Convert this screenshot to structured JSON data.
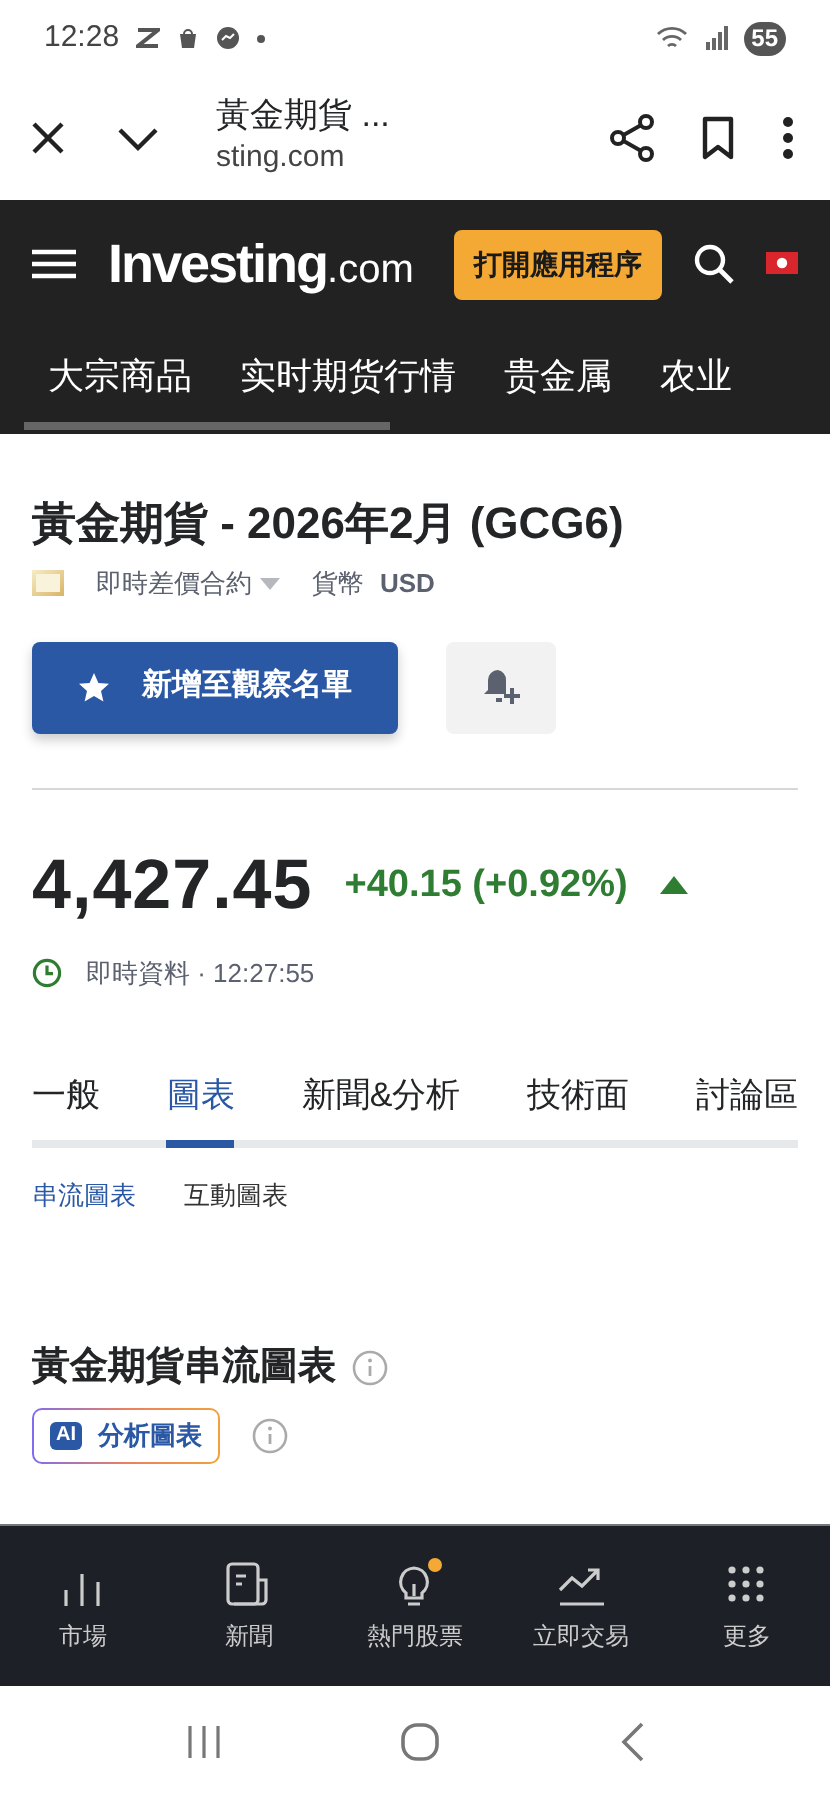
{
  "status_bar": {
    "time": "12:28",
    "battery": "55"
  },
  "browser": {
    "title": "黃金期貨 ...",
    "url": "sting.com"
  },
  "header": {
    "logo_main": "Investing",
    "logo_suffix": ".com",
    "cta": "打開應用程序"
  },
  "categories": [
    {
      "label": "大宗商品"
    },
    {
      "label": "实时期货行情"
    },
    {
      "label": "贵金属"
    },
    {
      "label": "农业"
    }
  ],
  "instrument": {
    "title": "黃金期貨 - 2026年2月 (GCG6)",
    "contract_type": "即時差價合約",
    "currency_label": "貨幣",
    "currency": "USD"
  },
  "watchlist_button": "新增至觀察名單",
  "price": {
    "last": "4,427.45",
    "change": "+40.15 (+0.92%)",
    "rising": true,
    "status": "即時資料 · 12:27:55"
  },
  "tabs": [
    {
      "label": "一般",
      "selected": false
    },
    {
      "label": "圖表",
      "selected": true
    },
    {
      "label": "新聞&分析",
      "selected": false
    },
    {
      "label": "技術面",
      "selected": false
    },
    {
      "label": "討論區",
      "selected": false
    }
  ],
  "subtabs": [
    {
      "label": "串流圖表",
      "selected": true
    },
    {
      "label": "互動圖表",
      "selected": false
    }
  ],
  "section": {
    "title": "黃金期貨串流圖表",
    "ai_badge": "AI",
    "ai_label": "分析圖表"
  },
  "bottom_nav": [
    {
      "kind": "markets",
      "label": "市場",
      "dot": false
    },
    {
      "kind": "news",
      "label": "新聞",
      "dot": false
    },
    {
      "kind": "ideas",
      "label": "熱門股票",
      "dot": true
    },
    {
      "kind": "trade",
      "label": "立即交易",
      "dot": false
    },
    {
      "kind": "more",
      "label": "更多",
      "dot": false
    }
  ]
}
